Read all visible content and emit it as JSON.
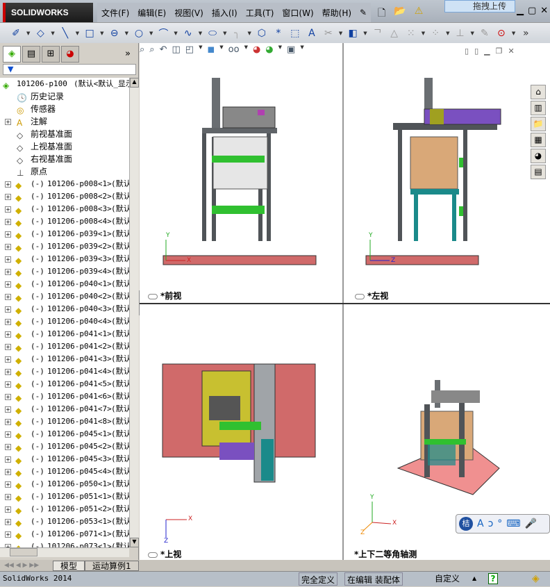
{
  "app": {
    "logo": "SOLIDWORKS",
    "status_text": "SolidWorks 2014"
  },
  "menu": [
    "文件(F)",
    "编辑(E)",
    "视图(V)",
    "插入(I)",
    "工具(T)",
    "窗口(W)",
    "帮助(H)"
  ],
  "upload_label": "拖拽上传",
  "filter_icon": "filter-icon",
  "tree": {
    "root": {
      "name": "101206-p100",
      "config": "(默认<默认_显示"
    },
    "features": [
      "历史记录",
      "传感器",
      "注解",
      "前视基准面",
      "上视基准面",
      "右视基准面",
      "原点"
    ],
    "components": [
      "101206-p008<1>",
      "101206-p008<2>",
      "101206-p008<3>",
      "101206-p008<4>",
      "101206-p039<1>",
      "101206-p039<2>",
      "101206-p039<3>",
      "101206-p039<4>",
      "101206-p040<1>",
      "101206-p040<2>",
      "101206-p040<3>",
      "101206-p040<4>",
      "101206-p041<1>",
      "101206-p041<2>",
      "101206-p041<3>",
      "101206-p041<4>",
      "101206-p041<5>",
      "101206-p041<6>",
      "101206-p041<7>",
      "101206-p041<8>",
      "101206-p045<1>",
      "101206-p045<2>",
      "101206-p045<3>",
      "101206-p045<4>",
      "101206-p050<1>",
      "101206-p051<1>",
      "101206-p051<2>",
      "101206-p053<1>",
      "101206-p071<1>",
      "101206-p073<1>"
    ],
    "component_prefix": "(-)",
    "component_config": "(默认"
  },
  "viewports": [
    {
      "label": "*前视",
      "axes": [
        "Y",
        "X"
      ]
    },
    {
      "label": "*左视",
      "axes": [
        "Y",
        "Z"
      ]
    },
    {
      "label": "*上视",
      "axes": [
        "X",
        "Z"
      ]
    },
    {
      "label": "*上下二等角轴测",
      "axes": [
        "Y",
        "X",
        "Z"
      ]
    }
  ],
  "bottom_tabs": [
    "模型",
    "运动算例1"
  ],
  "status": {
    "definition": "完全定义",
    "mode": "在编辑 装配体",
    "units": "自定义"
  },
  "colors": {
    "plate": "#d06a6a",
    "green": "#30c030",
    "wood": "#d9a878",
    "teal": "#1a8a8a",
    "frame": "#505458"
  }
}
